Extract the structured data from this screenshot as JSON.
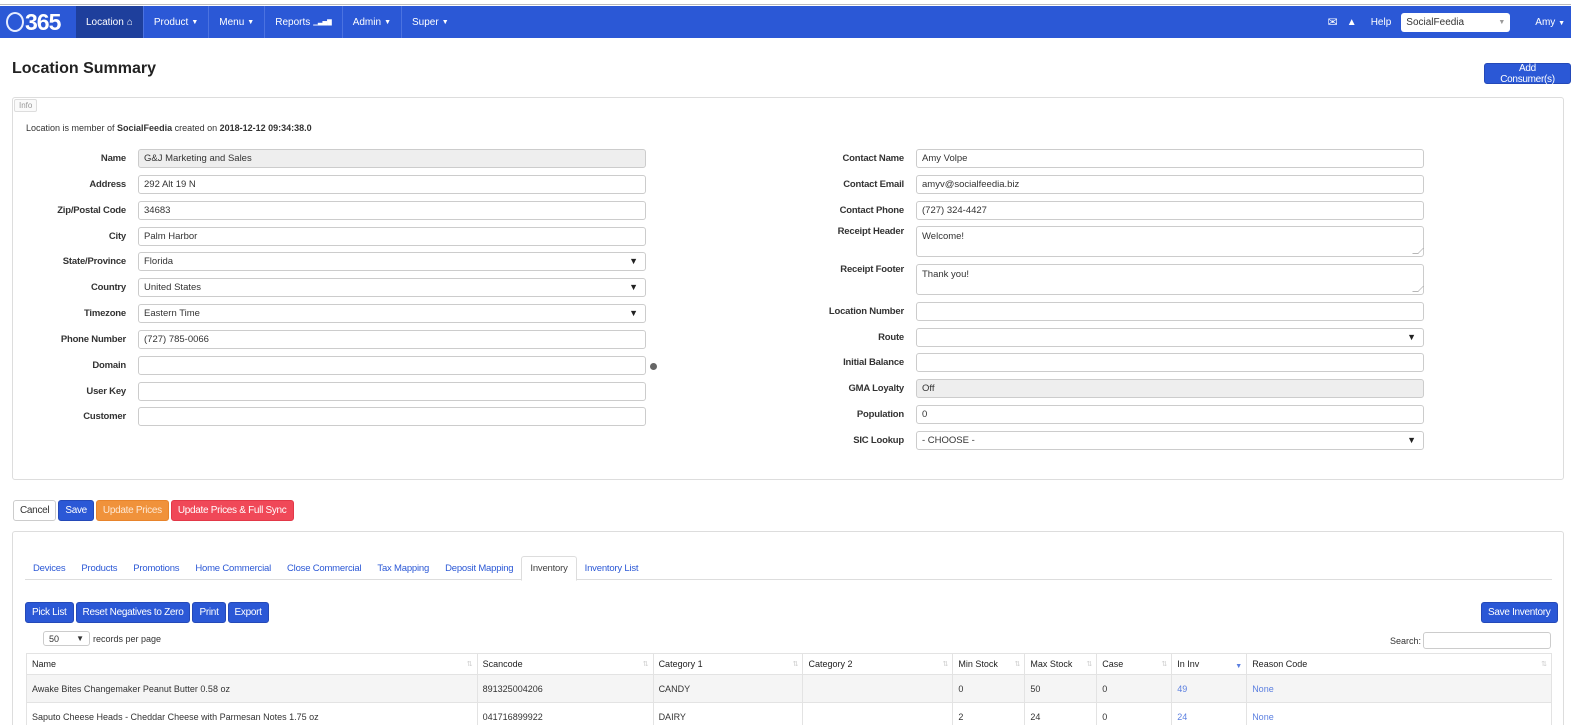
{
  "navbar": {
    "brand": "365",
    "items": [
      {
        "label": "Location",
        "icon": "home-icon",
        "glyph": "⌂",
        "active": true
      },
      {
        "label": "Product",
        "caret": true
      },
      {
        "label": "Menu",
        "caret": true
      },
      {
        "label": "Reports",
        "icon": "signal-icon",
        "glyph": "▁▃▅▇"
      },
      {
        "label": "Admin",
        "caret": true
      },
      {
        "label": "Super",
        "caret": true
      }
    ],
    "mail_glyph": "✉",
    "bell_glyph": "🔔",
    "help_label": "Help",
    "org_select": "SocialFeedia",
    "user": "Amy",
    "caret_glyph": "▾"
  },
  "page": {
    "title": "Location Summary",
    "add_consumer_label": "Add Consumer(s)"
  },
  "info": {
    "tag": "Info",
    "member_prefix": "Location is member of ",
    "org": "SocialFeedia",
    "created_prefix": " created on ",
    "created": "2018-12-12 09:34:38.0"
  },
  "left_fields": [
    {
      "label": "Name",
      "value": "G&J Marketing and Sales",
      "readonly": true
    },
    {
      "label": "Address",
      "value": "292 Alt 19 N"
    },
    {
      "label": "Zip/Postal Code",
      "value": "34683"
    },
    {
      "label": "City",
      "value": "Palm Harbor"
    },
    {
      "label": "State/Province",
      "value": "Florida",
      "select": true
    },
    {
      "label": "Country",
      "value": "United States",
      "select": true
    },
    {
      "label": "Timezone",
      "value": "Eastern Time",
      "select": true
    },
    {
      "label": "Phone Number",
      "value": "(727) 785-0066"
    },
    {
      "label": "Domain",
      "value": "",
      "help": true
    },
    {
      "label": "User Key",
      "value": ""
    },
    {
      "label": "Customer",
      "value": ""
    }
  ],
  "right_fields": [
    {
      "label": "Contact Name",
      "value": "Amy Volpe"
    },
    {
      "label": "Contact Email",
      "value": "amyv@socialfeedia.biz"
    },
    {
      "label": "Contact Phone",
      "value": "(727) 324-4427"
    },
    {
      "label": "Receipt Header",
      "value": "Welcome!",
      "textarea": true
    },
    {
      "label": "Receipt Footer",
      "value": "Thank you!",
      "textarea": true
    },
    {
      "label": "Location Number",
      "value": ""
    },
    {
      "label": "Route",
      "value": "",
      "select": true
    },
    {
      "label": "Initial Balance",
      "value": ""
    },
    {
      "label": "GMA Loyalty",
      "value": "Off",
      "readonly": true
    },
    {
      "label": "Population",
      "value": "0"
    },
    {
      "label": "SIC Lookup",
      "value": "- CHOOSE -",
      "select": true
    }
  ],
  "actions": {
    "cancel": "Cancel",
    "save": "Save",
    "update_prices": "Update Prices",
    "update_full_sync": "Update Prices & Full Sync"
  },
  "tabs": [
    "Devices",
    "Products",
    "Promotions",
    "Home Commercial",
    "Close Commercial",
    "Tax Mapping",
    "Deposit Mapping",
    "Inventory",
    "Inventory List"
  ],
  "active_tab": "Inventory",
  "inventory": {
    "tools": [
      "Pick List",
      "Reset Negatives to Zero",
      "Print",
      "Export"
    ],
    "save_label": "Save Inventory",
    "records_value": "50",
    "records_label": "records per page",
    "search_label": "Search:",
    "columns": [
      "Name",
      "Scancode",
      "Category 1",
      "Category 2",
      "Min Stock",
      "Max Stock",
      "Case",
      "In Inv",
      "Reason Code"
    ],
    "sorted_column": "In Inv",
    "rows": [
      [
        "Awake Bites Changemaker Peanut Butter 0.58 oz",
        "891325004206",
        "CANDY",
        "",
        "0",
        "50",
        "0",
        "49",
        "None"
      ],
      [
        "Saputo Cheese Heads - Cheddar Cheese with Parmesan Notes 1.75 oz",
        "041716899922",
        "DAIRY",
        "",
        "2",
        "24",
        "0",
        "24",
        "None"
      ]
    ]
  }
}
